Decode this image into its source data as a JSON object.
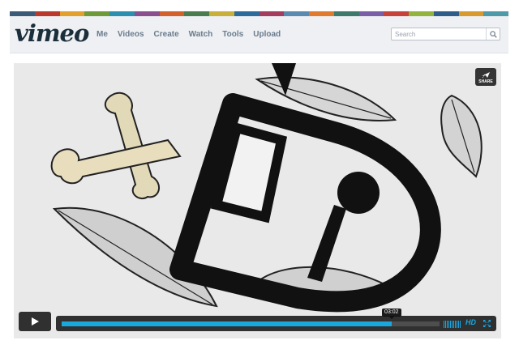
{
  "brand": {
    "logo_text": "vimeo",
    "stripe_colors": [
      "#3a5a78",
      "#b9392f",
      "#e2a12c",
      "#6f9a3a",
      "#2c8fb0",
      "#8a4f8f",
      "#d2612b",
      "#4a7d4e",
      "#c9b03a",
      "#2b6a9a",
      "#a33c5d",
      "#5a8ab0",
      "#e07a2f",
      "#3d7a6b",
      "#7b5ea8",
      "#c7423a",
      "#92b33e",
      "#2f5d8a",
      "#d89a2e",
      "#4f9aa8"
    ]
  },
  "nav": {
    "items": [
      "Me",
      "Videos",
      "Create",
      "Watch",
      "Tools",
      "Upload"
    ]
  },
  "search": {
    "placeholder": "Search",
    "icon": "magnifier-icon"
  },
  "player": {
    "share_label": "SHARE",
    "current_time": "03:02",
    "progress": 0.873,
    "loaded": 1.0,
    "volume_level": 1.0,
    "hd_label": "HD",
    "accent_color": "#1aa7de",
    "icons": {
      "play": "play-icon",
      "share": "paper-plane-icon",
      "fullscreen": "fullscreen-icon"
    }
  }
}
